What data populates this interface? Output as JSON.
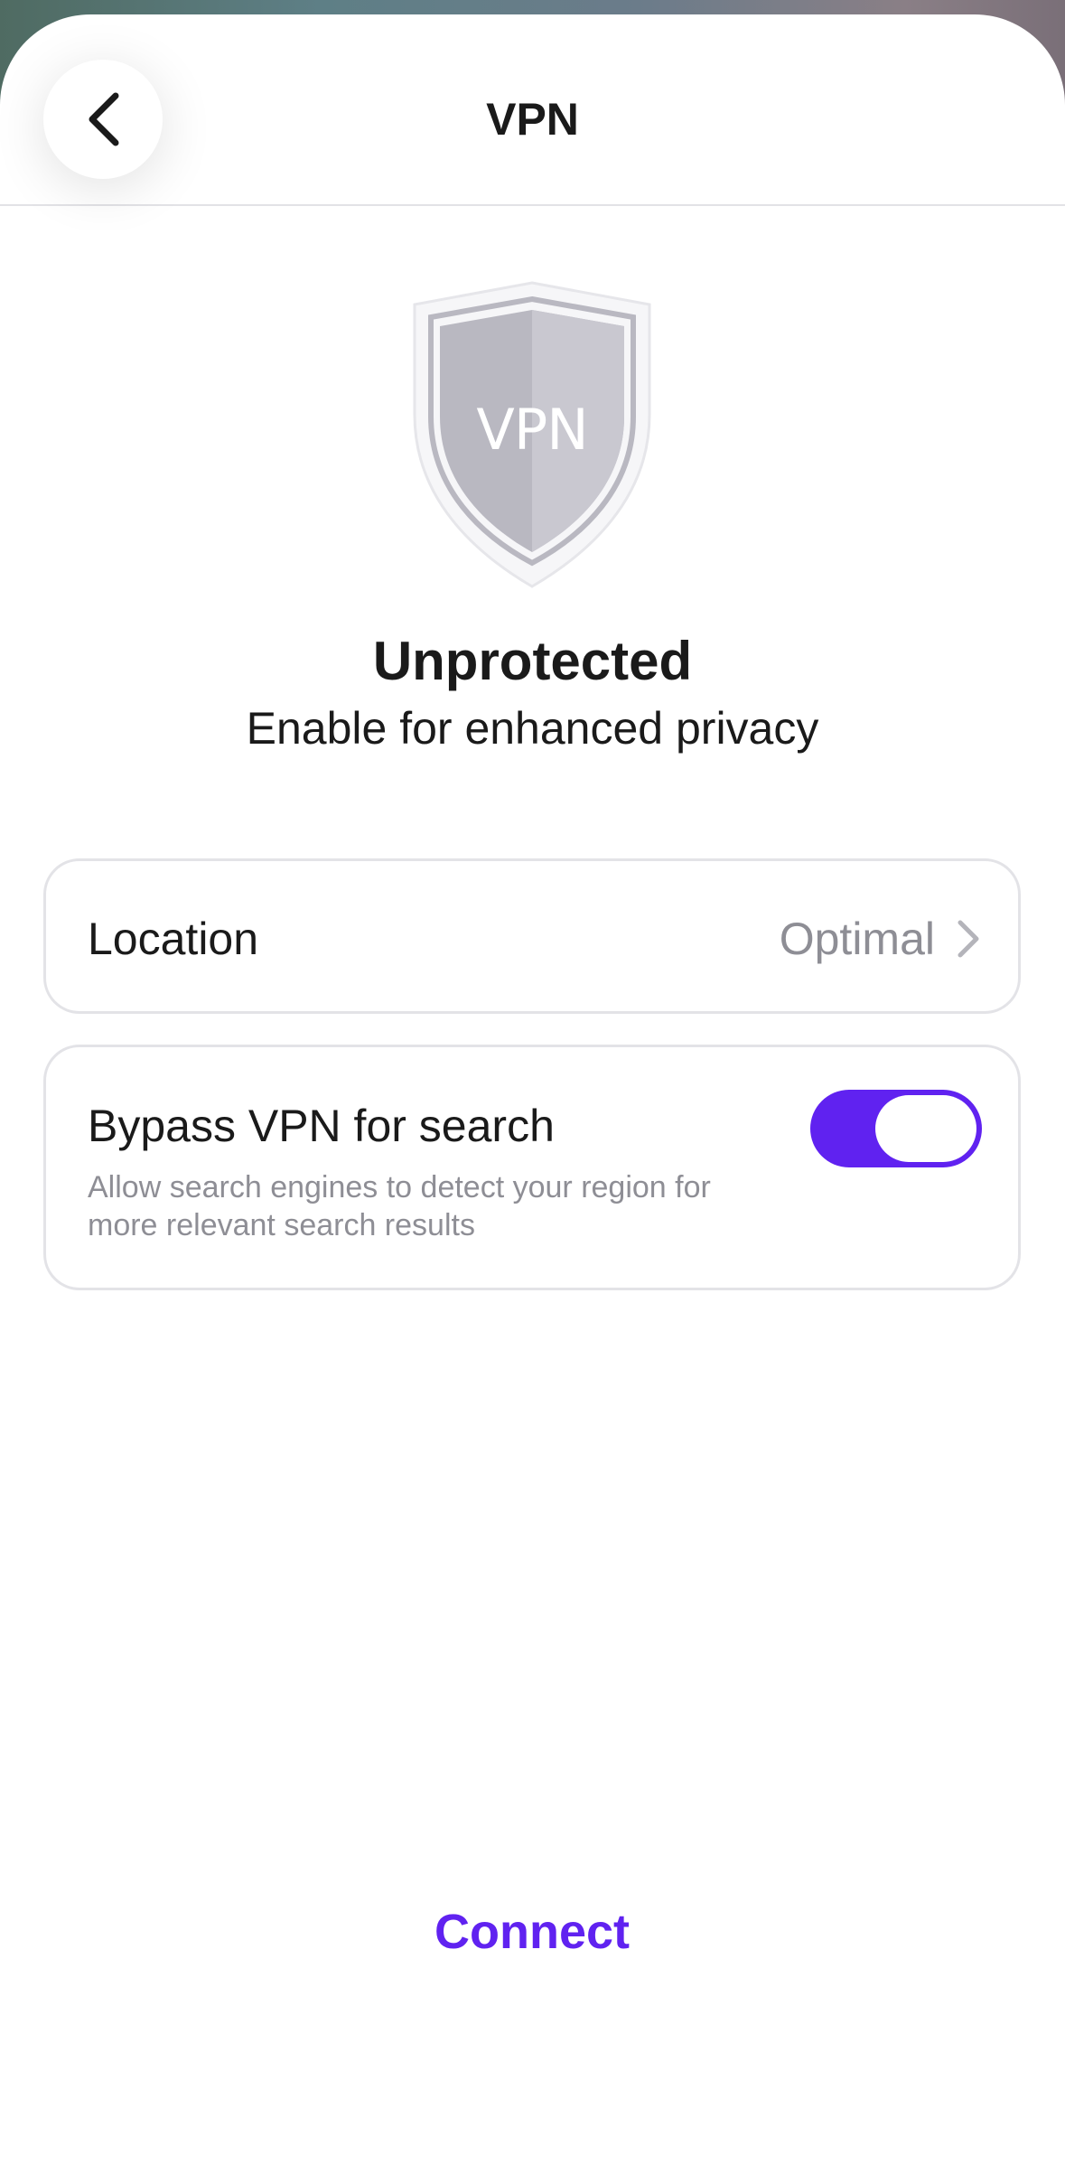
{
  "header": {
    "title": "VPN",
    "back_icon": "chevron-left-icon"
  },
  "shield": {
    "label": "VPN",
    "icon": "shield-icon"
  },
  "status": {
    "title": "Unprotected",
    "subtitle": "Enable for enhanced privacy"
  },
  "location": {
    "label": "Location",
    "value": "Optimal",
    "icon": "chevron-right-icon"
  },
  "bypass": {
    "title": "Bypass VPN for search",
    "description": "Allow search engines to detect your region for more relevant search results",
    "enabled": true
  },
  "connect": {
    "label": "Connect"
  },
  "colors": {
    "accent": "#6022f0",
    "secondary_text": "#8e8e95",
    "shield_fill": "#b9b8c1"
  }
}
